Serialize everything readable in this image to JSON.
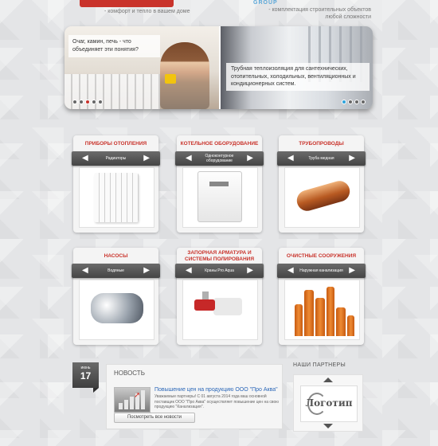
{
  "header": {
    "tagline_left": "- комфорт и тепло в вашем доме",
    "group_mark": "GROUP",
    "tagline_right": "- комплектация строительных объектов любой сложности"
  },
  "slider": {
    "slide1_caption": "Очаг, камин, печь - что объединяет эти понятия?",
    "slide2_caption": "Трубная теплоизоляция для сантехнических, отопительных, холодильных, вентиляционных и кондиционерных систем."
  },
  "categories": [
    {
      "title": "ПРИБОРЫ ОТОПЛЕНИЯ",
      "subtitle": "Радиаторы"
    },
    {
      "title": "КОТЕЛЬНОЕ ОБОРУДОВАНИЕ",
      "subtitle": "Одноконтурное оборудование"
    },
    {
      "title": "ТРУБОПРОВОДЫ",
      "subtitle": "Труба медная"
    },
    {
      "title": "НАСОСЫ",
      "subtitle": "Водяные"
    },
    {
      "title": "ЗАПОРНАЯ АРМАТУРА И СИСТЕМЫ ПОЛИРОВАНИЯ",
      "subtitle": "Краны Pro Aqua"
    },
    {
      "title": "ОЧИСТНЫЕ СООРУЖЕНИЯ",
      "subtitle": "Наружная канализация"
    }
  ],
  "news": {
    "date_month": "июнь",
    "date_day": "17",
    "heading": "НОВОСТЬ",
    "link_text": "Повышение цен на продукцию ООО \"Про Аква\"",
    "body_text": "Уважаемые партнеры! С 01 августа 2014 года ваш основной поставщик ООО \"Про Аква\" осуществляет повышение цен на свою продукцию \"Канализация\".",
    "button_label": "Посмотреть все новости"
  },
  "partners": {
    "heading": "НАШИ ПАРТНЕРЫ",
    "logo_text": "Логотип"
  },
  "colors": {
    "accent_red": "#c9332b",
    "link_blue": "#2b67b8",
    "dot_blue": "#2ea3dc"
  },
  "icons": [
    "arrow-left-icon",
    "arrow-right-icon",
    "arrow-up-icon",
    "arrow-down-icon",
    "slider-dot-icon"
  ]
}
